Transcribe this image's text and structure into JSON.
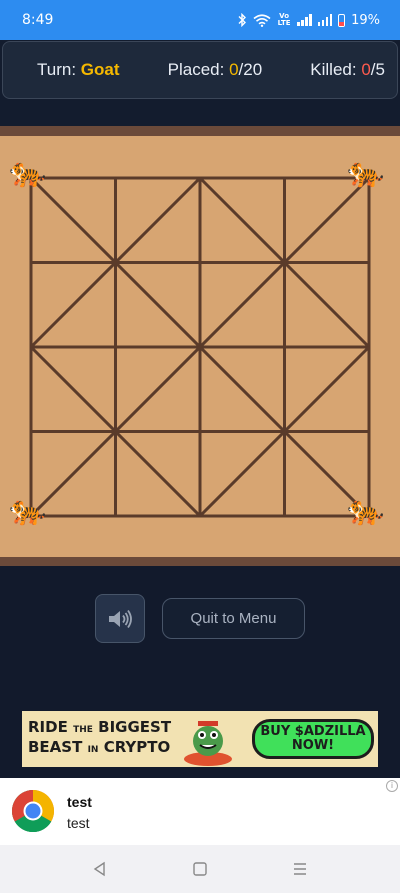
{
  "status_bar": {
    "time": "8:49",
    "network_text": "Vo LTE",
    "battery": "19%"
  },
  "stats": {
    "turn_label": "Turn:",
    "turn_value": "Goat",
    "placed_label": "Placed:",
    "placed_count": "0",
    "placed_total": "/20",
    "killed_label": "Killed:",
    "killed_count": "0",
    "killed_total": "/5"
  },
  "board": {
    "grid_size": 5,
    "pieces": [
      {
        "type": "tiger",
        "row": 0,
        "col": 0
      },
      {
        "type": "tiger",
        "row": 0,
        "col": 4
      },
      {
        "type": "tiger",
        "row": 4,
        "col": 0
      },
      {
        "type": "tiger",
        "row": 4,
        "col": 4
      }
    ],
    "tiger_glyph": "🐅"
  },
  "controls": {
    "sound_icon": "speaker-icon",
    "quit_label": "Quit to Menu"
  },
  "ad": {
    "line1_big": "RIDE",
    "line1_small": "THE",
    "line1_end": "BIGGEST",
    "line2_big": "BEAST",
    "line2_small": "IN",
    "line2_end": "CRYPTO",
    "cta_line1": "BUY $ADZILLA",
    "cta_line2": "NOW!"
  },
  "notification": {
    "title": "test",
    "body": "test",
    "info": "i"
  },
  "colors": {
    "accent_yellow": "#f5b800",
    "accent_red": "#ff5a4e",
    "board": "#d7a572",
    "board_lines": "#5a3b2a"
  }
}
